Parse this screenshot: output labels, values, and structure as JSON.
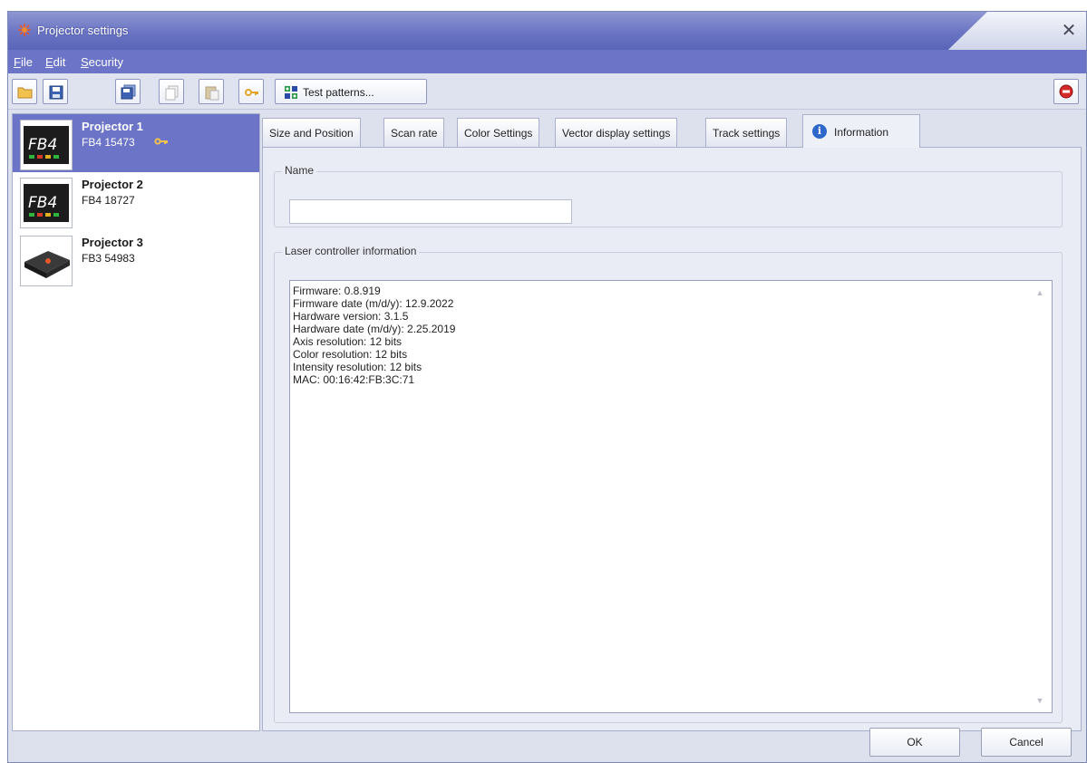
{
  "window": {
    "title": "Projector settings",
    "close_glyph": "✕"
  },
  "menu": [
    {
      "first": "F",
      "rest": "ile"
    },
    {
      "first": "E",
      "rest": "dit"
    },
    {
      "first": "S",
      "rest": "ecurity"
    }
  ],
  "toolbar": {
    "icons": [
      "open-folder-icon",
      "save-icon",
      "save-all-icon",
      "copy-icon",
      "paste-icon",
      "key-icon"
    ],
    "test_patterns_label": "Test patterns...",
    "stop_icon": "stop-icon"
  },
  "projectors": [
    {
      "name": "Projector 1",
      "serial": "FB4 15473",
      "model": "FB4",
      "has_key": true
    },
    {
      "name": "Projector 2",
      "serial": "FB4 18727",
      "model": "FB4",
      "has_key": false
    },
    {
      "name": "Projector 3",
      "serial": "FB3 54983",
      "model": "FB3",
      "has_key": false
    }
  ],
  "tabs": [
    "Size and Position",
    "Scan rate",
    "Color Settings",
    "Vector display settings",
    "Track settings",
    "Information"
  ],
  "active_tab": "Information",
  "name_group": {
    "label": "Name",
    "value": ""
  },
  "laser_info": {
    "label": "Laser controller information",
    "lines": [
      "Firmware: 0.8.919",
      "Firmware date (m/d/y): 12.9.2022",
      "Hardware version: 3.1.5",
      "Hardware date (m/d/y): 2.25.2019",
      "Axis resolution: 12 bits",
      "Color resolution: 12 bits",
      "Intensity resolution: 12 bits",
      "MAC: 00:16:42:FB:3C:71"
    ]
  },
  "buttons": {
    "ok": "OK",
    "cancel": "Cancel"
  },
  "colors": {
    "accent": "#6b74c6",
    "panel_bg": "#eaecf5"
  }
}
